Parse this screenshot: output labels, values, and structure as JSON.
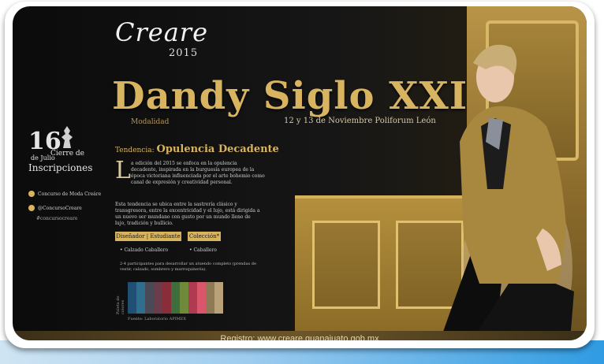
{
  "poster": {
    "logo": "Creare",
    "logo_year": "2015",
    "title": "Dandy Siglo XXI",
    "modalidad": "Modalidad",
    "dates": "12 y 13 de Noviembre Poliforum León",
    "sidebar": {
      "day": "16",
      "month": "de Julio",
      "cierre": "Cierre de",
      "inscripciones": "Inscripciones",
      "social": [
        {
          "icon": "facebook-icon",
          "text": "Concurso de Moda Creáre"
        },
        {
          "icon": "twitter-icon",
          "text": "@ConcursoCreare"
        }
      ],
      "hashtag": "#concursocreare"
    },
    "tendencia_label": "Tendencia:",
    "tendencia_value": "Opulencia Decadente",
    "dropcap": "L",
    "paragraph1": "a edición del 2015 se enfoca en la opulencia decadente, inspirada en la burguesía europea de la época victoriana influenciada por el arte bohemio como canal de expresión y creatividad personal.",
    "paragraph2": "Esta tendencia se ubica entre la sastrería clásico y transgresora, entre la excentricidad y el lujo, está dirigida a un nuevo ser mundano con gusto por un mundo lleno de lujo, tradición y bullicio.",
    "categories": {
      "box1": "Diseñador | Estudiante",
      "box2": "Colección*",
      "item1": "• Calzado Caballero",
      "item2": "• Caballero",
      "note": "2-4 participantes para desarrollar un atuendo completo (prendas de vestir, calzado, sombrero y marroquinería)."
    },
    "palette_label": "Paleta de colores",
    "palette_colors": [
      "#1f4f73",
      "#2f6f8d",
      "#4a4a56",
      "#6b3d4a",
      "#8a2d3a",
      "#3d6e3b",
      "#6e8a3a",
      "#b03a52",
      "#d9566b",
      "#8e7a55",
      "#b9a27a"
    ],
    "source": "Fuente: Laboratorio APIMEX",
    "footer": "Registro: www.creare.guanajuato.gob.mx"
  }
}
